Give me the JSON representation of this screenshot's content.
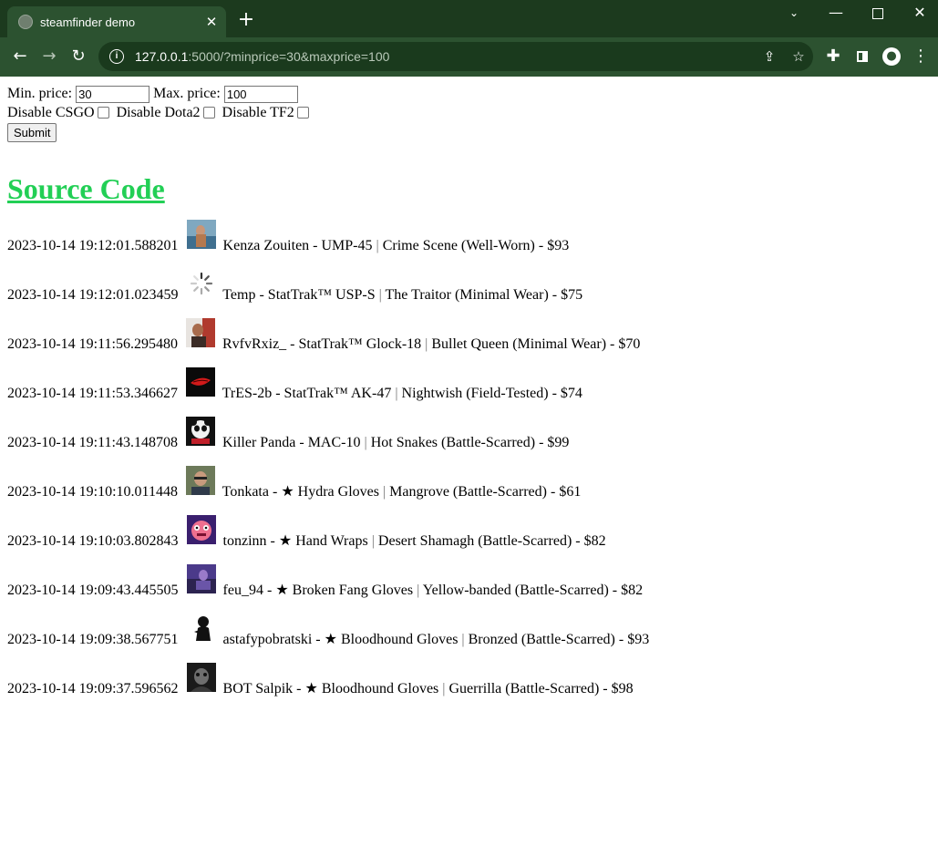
{
  "browser": {
    "tab_title": "steamfinder demo",
    "url_host": "127.0.0.1",
    "url_rest": ":5000/?minprice=30&maxprice=100",
    "accent_color": "#1c3a1e"
  },
  "form": {
    "min_label": "Min. price:",
    "min_value": "30",
    "max_label": "Max. price:",
    "max_value": "100",
    "disable_csgo_label": "Disable CSGO",
    "disable_dota2_label": "Disable Dota2",
    "disable_tf2_label": "Disable TF2",
    "submit_label": "Submit"
  },
  "source_link": {
    "label": "Source Code",
    "color": "#22cf55"
  },
  "listings": [
    {
      "timestamp": "2023-10-14 19:12:01.588201",
      "seller": "Kenza Zouiten",
      "weapon": "UMP-45",
      "skin": "Crime Scene (Well-Worn)",
      "price": "$93",
      "avatar": "photo-avatar"
    },
    {
      "timestamp": "2023-10-14 19:12:01.023459",
      "seller": "Temp",
      "weapon": "StatTrak™ USP-S",
      "skin": "The Traitor (Minimal Wear)",
      "price": "$75",
      "avatar": "loading-spinner-icon"
    },
    {
      "timestamp": "2023-10-14 19:11:56.295480",
      "seller": "RvfvRxiz_",
      "weapon": "StatTrak™ Glock-18",
      "skin": "Bullet Queen (Minimal Wear)",
      "price": "$70",
      "avatar": "photo-avatar"
    },
    {
      "timestamp": "2023-10-14 19:11:53.346627",
      "seller": "TrES-2b",
      "weapon": "StatTrak™ AK-47",
      "skin": "Nightwish (Field-Tested)",
      "price": "$74",
      "avatar": "lips-avatar"
    },
    {
      "timestamp": "2023-10-14 19:11:43.148708",
      "seller": "Killer Panda",
      "weapon": "MAC-10",
      "skin": "Hot Snakes (Battle-Scarred)",
      "price": "$99",
      "avatar": "panda-avatar"
    },
    {
      "timestamp": "2023-10-14 19:10:10.011448",
      "seller": "Tonkata",
      "weapon": "★ Hydra Gloves",
      "skin": "Mangrove (Battle-Scarred)",
      "price": "$61",
      "avatar": "photo-avatar"
    },
    {
      "timestamp": "2023-10-14 19:10:03.802843",
      "seller": "tonzinn",
      "weapon": "★ Hand Wraps",
      "skin": "Desert Shamagh (Battle-Scarred)",
      "price": "$82",
      "avatar": "pink-creature-avatar"
    },
    {
      "timestamp": "2023-10-14 19:09:43.445505",
      "seller": "feu_94",
      "weapon": "★ Broken Fang Gloves",
      "skin": "Yellow-banded (Battle-Scarred)",
      "price": "$82",
      "avatar": "photo-avatar"
    },
    {
      "timestamp": "2023-10-14 19:09:38.567751",
      "seller": "astafypobratski",
      "weapon": "★ Bloodhound Gloves",
      "skin": "Bronzed (Battle-Scarred)",
      "price": "$93",
      "avatar": "silhouette-avatar"
    },
    {
      "timestamp": "2023-10-14 19:09:37.596562",
      "seller": "BOT Salpik",
      "weapon": "★ Bloodhound Gloves",
      "skin": "Guerrilla (Battle-Scarred)",
      "price": "$98",
      "avatar": "photo-avatar"
    }
  ]
}
